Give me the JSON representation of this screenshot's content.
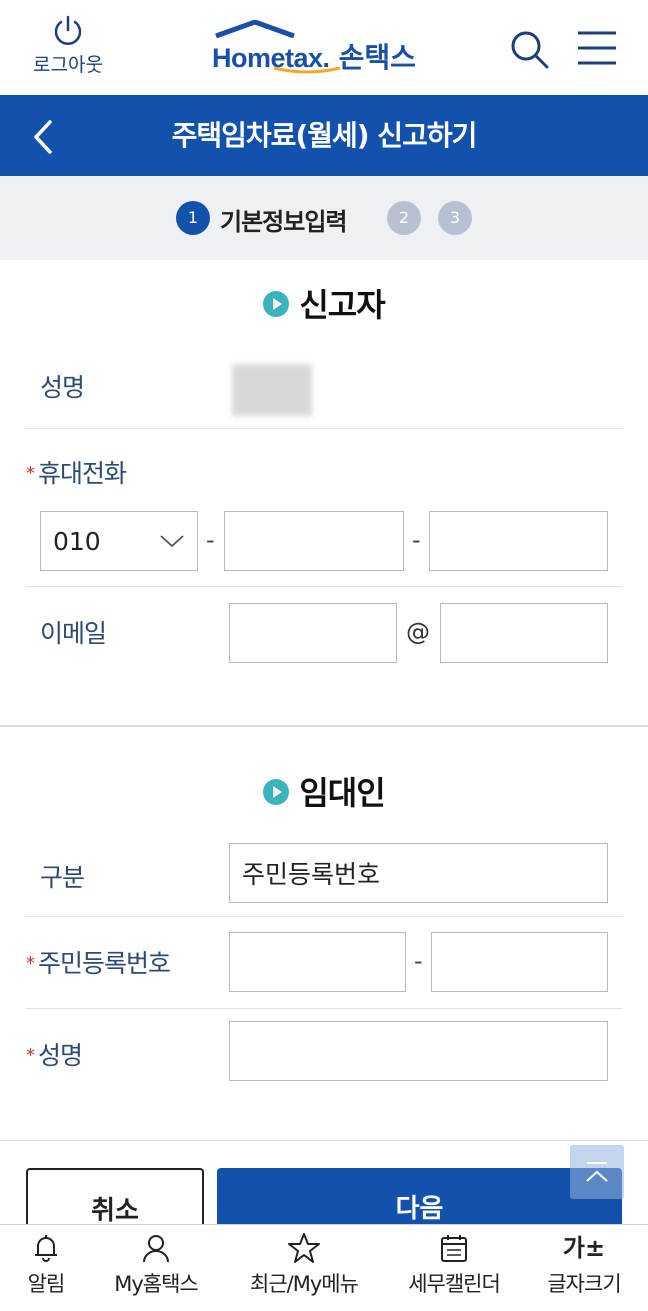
{
  "header": {
    "logout_label": "로그아웃",
    "logo_home": "Hometax.",
    "logo_app": "손택스"
  },
  "title_bar": {
    "title": "주택임차료(월세) 신고하기"
  },
  "stepper": {
    "steps": [
      {
        "number": "1",
        "label": "기본정보입력",
        "active": true
      },
      {
        "number": "2",
        "active": false
      },
      {
        "number": "3",
        "active": false
      }
    ]
  },
  "reporter": {
    "heading": "신고자",
    "name_label": "성명",
    "phone_label": "휴대전화",
    "phone_prefix": "010",
    "email_label": "이메일",
    "email_at": "@"
  },
  "landlord": {
    "heading": "임대인",
    "type_label": "구분",
    "type_value": "주민등록번호",
    "rrn_label": "주민등록번호",
    "name_label": "성명"
  },
  "buttons": {
    "cancel": "취소",
    "next": "다음"
  },
  "bottom_nav": [
    {
      "label": "알림",
      "icon": "bell-icon"
    },
    {
      "label": "My홈택스",
      "icon": "person-icon"
    },
    {
      "label": "최근/My메뉴",
      "icon": "star-icon"
    },
    {
      "label": "세무캘린더",
      "icon": "calendar-icon"
    },
    {
      "label": "글자크기",
      "icon": "font-size-icon",
      "glyph": "가±"
    }
  ],
  "colors": {
    "primary": "#1352ac",
    "accent": "#3bb3be",
    "required": "#d0312d"
  }
}
